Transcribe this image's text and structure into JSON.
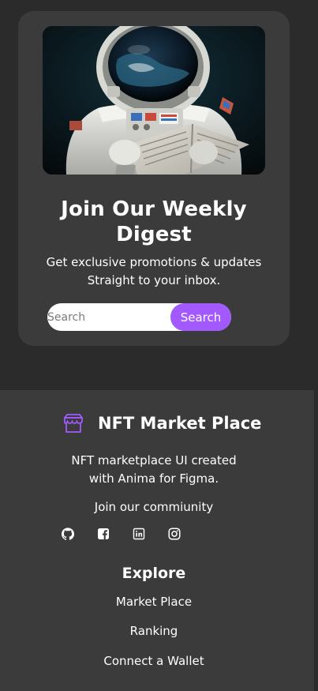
{
  "newsletter": {
    "image_alt": "astronaut reading a newspaper",
    "title_line1": "Join Our Weekly",
    "title_line2": "Digest",
    "subtitle_line1": "Get exclusive promotions & updates",
    "subtitle_line2": "Straight to your inbox.",
    "email_placeholder": "Search",
    "submit_label": "Search"
  },
  "footer": {
    "brand_icon": "storefront-icon",
    "brand_name": "NFT Market Place",
    "tagline_line1": "NFT marketplace UI created",
    "tagline_line2": "with Anima for Figma.",
    "community_label": "Join our commiunity",
    "socials": [
      {
        "icon": "github-icon"
      },
      {
        "icon": "facebook-icon"
      },
      {
        "icon": "linkedin-icon"
      },
      {
        "icon": "instagram-icon"
      }
    ],
    "explore_title": "Explore",
    "explore_links": [
      {
        "label": "Market Place"
      },
      {
        "label": "Ranking"
      },
      {
        "label": "Connect a Wallet"
      }
    ]
  },
  "colors": {
    "page_background": "#2b2b2b",
    "surface": "#3b3b3b",
    "accent": "#a259ff",
    "text": "#ffffff"
  }
}
